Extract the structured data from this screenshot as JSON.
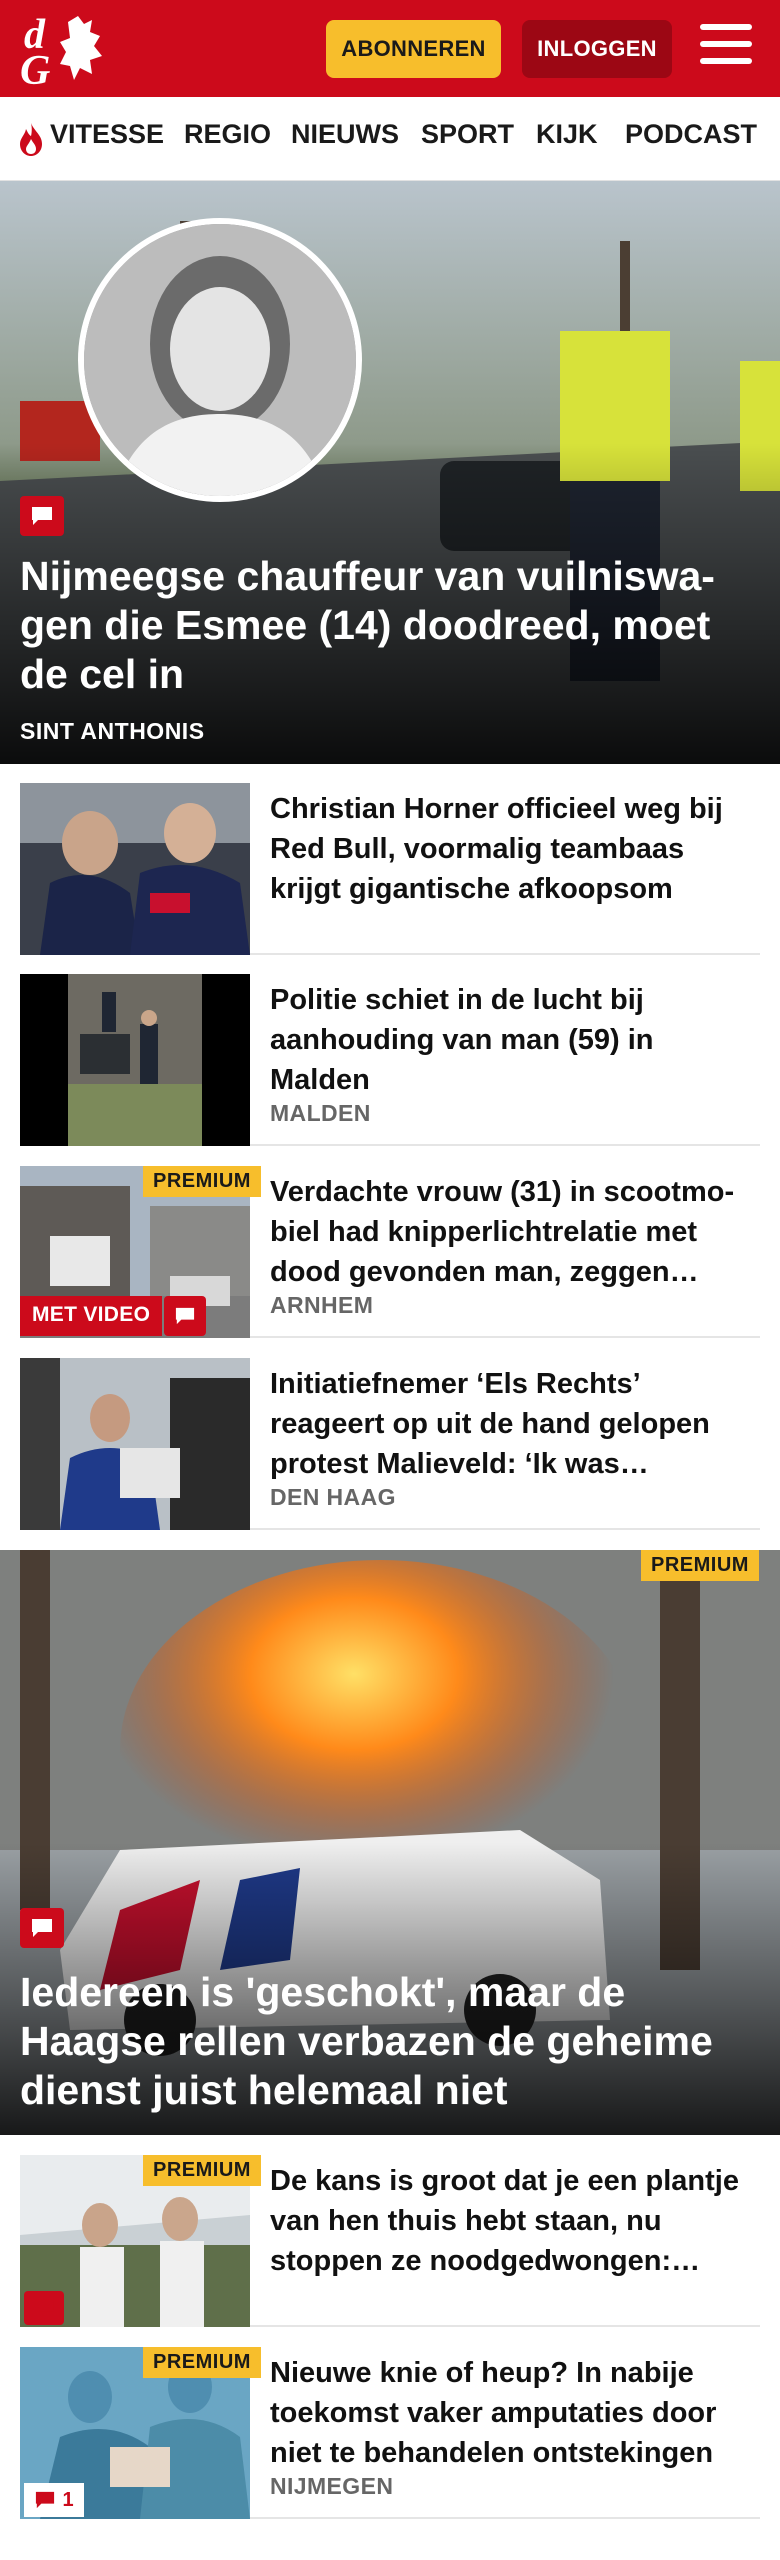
{
  "header": {
    "logo_text": "dG",
    "subscribe_label": "ABONNEREN",
    "login_label": "INLOGGEN"
  },
  "nav": {
    "items": [
      "VITESSE",
      "REGIO",
      "NIEUWS",
      "SPORT",
      "KIJK",
      "PODCAST"
    ]
  },
  "hero": {
    "title": "Nijmeegse chauffeur van vuilniswa­gen die Esmee (14) doodreed, moet de cel in",
    "location": "SINT ANTHONIS"
  },
  "articles": [
    {
      "title": "Christian Horner officieel weg bij Red Bull, voormalig teambaas krijgt gigantische afkoopsom",
      "location": ""
    },
    {
      "title": "Politie schiet in de lucht bij aanhouding van man (59) in Malden",
      "location": "MALDEN"
    },
    {
      "title": "Verdachte vrouw (31) in scootmo­biel had knipperlichtrelatie met dood gevonden man, zeggen…",
      "location": "ARNHEM",
      "premium": "PREMIUM",
      "video": "MET VIDEO"
    },
    {
      "title": "Initiatiefnemer ‘Els Rechts’ reageert op uit de hand gelopen protest Malieveld: ‘Ik was…",
      "location": "DEN HAAG"
    }
  ],
  "hero2": {
    "title": "Iedereen is 'geschokt', maar de Haagse rellen verbazen de geheime dienst juist helemaal niet",
    "premium": "PREMIUM"
  },
  "articles2": [
    {
      "title": "De kans is groot dat je een plantje van hen thuis hebt staan, nu stoppen ze noodgedwongen:…",
      "premium": "PREMIUM"
    },
    {
      "title": "Nieuwe knie of heup? In nabije toekomst vaker amputaties door niet te behandelen ontstekingen",
      "location": "NIJMEGEN",
      "premium": "PREMIUM",
      "comments": "1"
    }
  ],
  "colors": {
    "brand_red": "#cc0a1b",
    "subscribe_yellow": "#f7be2c",
    "login_dark_red": "#9c0714"
  }
}
